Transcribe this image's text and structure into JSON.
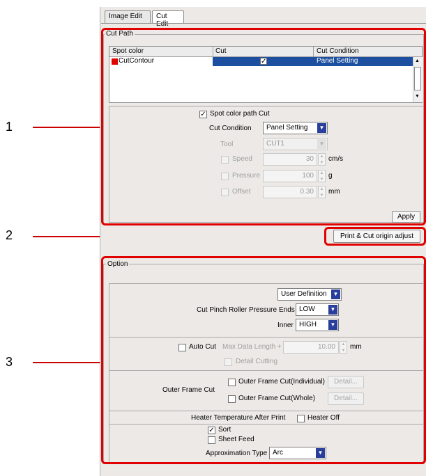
{
  "callouts": [
    "1",
    "2",
    "3"
  ],
  "tabs": [
    {
      "label": "Image Edit"
    },
    {
      "label": "Cut Edit"
    }
  ],
  "cut_path": {
    "legend": "Cut Path",
    "table": {
      "columns": [
        "Spot color",
        "Cut",
        "Cut Condition"
      ],
      "rows": [
        {
          "spot_color": "CutContour",
          "swatch": "#e00000",
          "cut": true,
          "condition": "Panel Setting"
        }
      ]
    },
    "spot_color_path_cut": {
      "label": "Spot color path Cut",
      "checked": true
    },
    "cut_condition": {
      "label": "Cut Condition",
      "value": "Panel Setting"
    },
    "tool": {
      "label": "Tool",
      "value": "CUT1"
    },
    "speed": {
      "label": "Speed",
      "value": "30",
      "unit": "cm/s"
    },
    "pressure": {
      "label": "Pressure",
      "value": "100",
      "unit": "g"
    },
    "offset": {
      "label": "Offset",
      "value": "0.30",
      "unit": "mm"
    },
    "apply_label": "Apply"
  },
  "origin_adjust_label": "Print & Cut origin adjust",
  "option": {
    "legend": "Option",
    "pinch": {
      "label": "Cut Pinch Roller Pressure",
      "mode": "User Definition",
      "ends_label": "Ends",
      "ends_value": "LOW",
      "inner_label": "Inner",
      "inner_value": "HIGH"
    },
    "auto_cut": {
      "label": "Auto Cut",
      "max_label": "Max Data Length +",
      "max_value": "10.00",
      "unit": "mm",
      "detail_cutting": "Detail Cutting"
    },
    "outer_frame": {
      "label": "Outer Frame Cut",
      "individual": "Outer Frame Cut(Individual)",
      "whole": "Outer Frame Cut(Whole)",
      "detail": "Detail..."
    },
    "heater": {
      "label": "Heater Temperature After Print",
      "checkbox": "Heater Off"
    },
    "sort": {
      "label": "Sort",
      "checked": true
    },
    "sheet_feed": {
      "label": "Sheet Feed",
      "checked": false
    },
    "approximation": {
      "label": "Approximation Type",
      "value": "Arc"
    }
  },
  "colors": {
    "highlight": "#e00000",
    "selection": "#1c4fa0",
    "panel": "#ece9e6",
    "dropdown_arrow": "#2a3e9b"
  }
}
